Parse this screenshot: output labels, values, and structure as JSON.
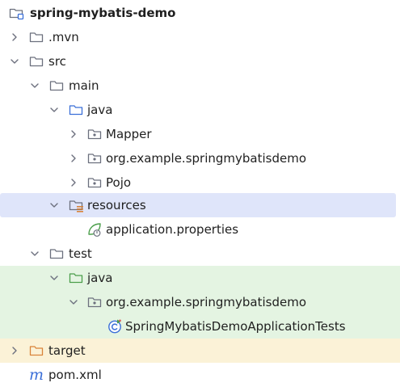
{
  "tree": {
    "root_label": "spring-mybatis-demo",
    "mvn_label": ".mvn",
    "src_label": "src",
    "main_label": "main",
    "main_java_label": "java",
    "mapper_label": "Mapper",
    "main_package_label": "org.example.springmybatisdemo",
    "pojo_label": "Pojo",
    "resources_label": "resources",
    "application_properties_label": "application.properties",
    "test_label": "test",
    "test_java_label": "java",
    "test_package_label": "org.example.springmybatisdemo",
    "test_class_label": "SpringMybatisDemoApplicationTests",
    "target_label": "target",
    "pom_label": "pom.xml"
  },
  "colors": {
    "selected_row": "#dfe5fa",
    "test_rows": "#e4f4e2",
    "excluded_row": "#fbf2d7",
    "source_root_folder": "#3b6fd8",
    "test_root_folder": "#4b9e4b",
    "excluded_folder": "#d9843a",
    "spring_icon": "#4b9e4b"
  }
}
